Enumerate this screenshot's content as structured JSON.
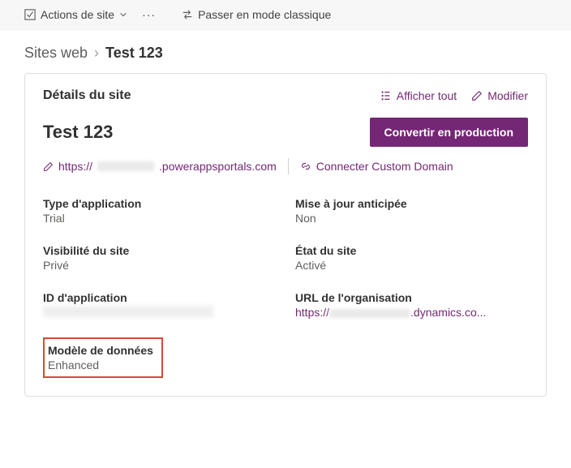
{
  "toolbar": {
    "site_actions": "Actions de site",
    "switch_classic": "Passer en mode classique"
  },
  "breadcrumb": {
    "root": "Sites web",
    "current": "Test 123"
  },
  "card": {
    "header": "Détails du site",
    "show_all": "Afficher tout",
    "edit": "Modifier"
  },
  "site": {
    "name": "Test 123",
    "convert_btn": "Convertir en production",
    "url_prefix": "https://",
    "url_suffix": ".powerappsportals.com",
    "connect_domain": "Connecter Custom Domain"
  },
  "fields": {
    "app_type_label": "Type d'application",
    "app_type_value": "Trial",
    "early_update_label": "Mise à jour anticipée",
    "early_update_value": "Non",
    "visibility_label": "Visibilité du site",
    "visibility_value": "Privé",
    "state_label": "État du site",
    "state_value": "Activé",
    "app_id_label": "ID d'application",
    "org_url_label": "URL de l'organisation",
    "org_url_prefix": "https://",
    "org_url_suffix": ".dynamics.co...",
    "data_model_label": "Modèle de données",
    "data_model_value": "Enhanced"
  }
}
